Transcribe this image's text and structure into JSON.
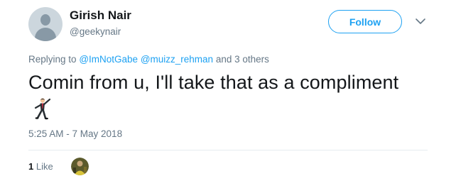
{
  "tweet": {
    "author": {
      "name": "Girish Nair",
      "handle": "@geekynair"
    },
    "follow_label": "Follow",
    "replying": {
      "prefix": "Replying to",
      "mentions": [
        "@ImNotGabe",
        "@muizz_rehman"
      ],
      "suffix": "and 3 others"
    },
    "text": "Comin from u, I'll take that as a compliment",
    "emoji_icon": "man-dancing-icon",
    "timestamp": "5:25 AM - 7 May 2018",
    "likes": {
      "count": "1",
      "label": "Like"
    }
  },
  "colors": {
    "accent": "#1da1f2",
    "muted": "#657786",
    "text": "#14171a",
    "divider": "#e6ecf0"
  }
}
